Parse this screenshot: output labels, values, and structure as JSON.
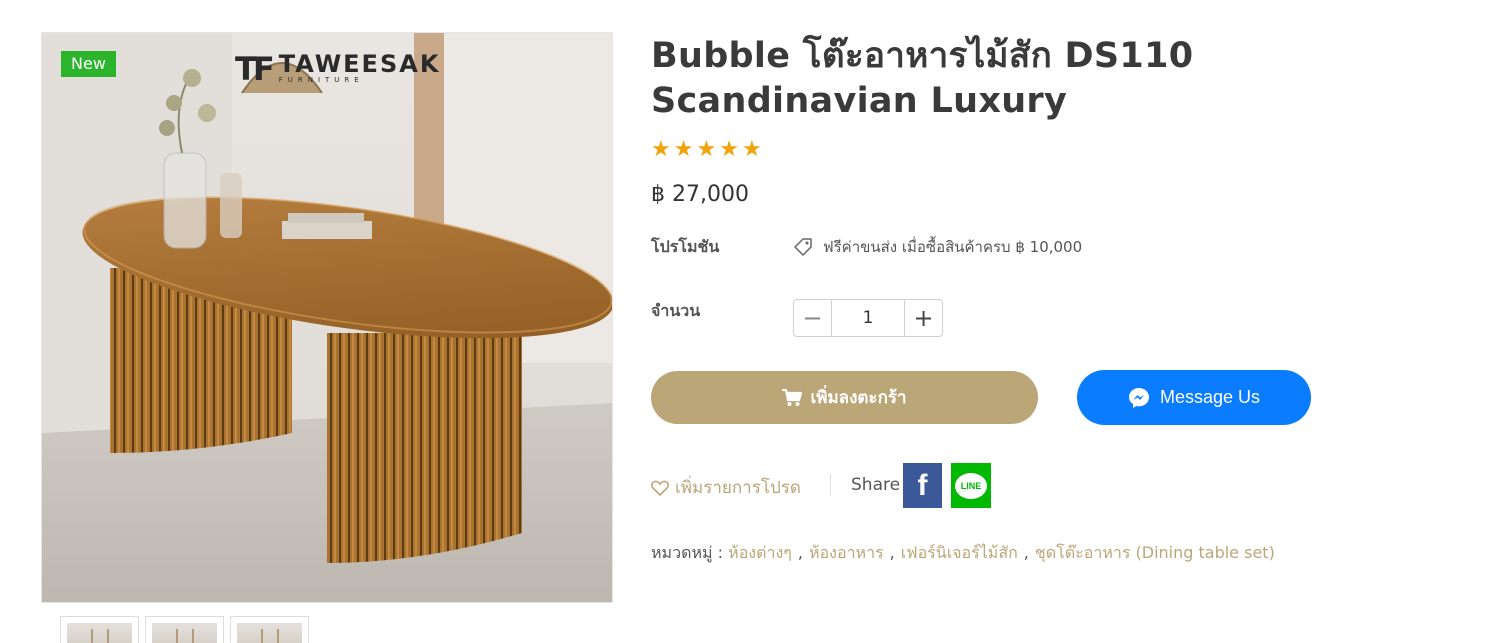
{
  "product_image": {
    "badge": "New",
    "brand_mark": "TF",
    "brand_name": "TAWEESAK",
    "brand_sub": "FURNITURE"
  },
  "thumbnails": [
    "thumb-1",
    "thumb-2",
    "thumb-3"
  ],
  "product": {
    "title": "Bubble โต๊ะอาหารไม้สัก DS110 Scandinavian Luxury",
    "rating": 5,
    "star_glyph": "★",
    "price": "฿ 27,000"
  },
  "promotion": {
    "label": "โปรโมชัน",
    "text": "ฟรีค่าขนส่ง เมื่อซื้อสินค้าครบ ฿ 10,000"
  },
  "quantity": {
    "label": "จำนวน",
    "value": "1",
    "minus": "−",
    "plus": "+"
  },
  "buttons": {
    "add_to_cart": "เพิ่มลงตะกร้า",
    "message_us": "Message Us"
  },
  "wishlist": {
    "label": "เพิ่มรายการโปรด"
  },
  "share": {
    "label": "Share",
    "facebook": "f",
    "line": "LINE"
  },
  "categories": {
    "label": "หมวดหมู่ :",
    "items": [
      "ห้องต่างๆ",
      "ห้องอาหาร",
      "เฟอร์นิเจอร์ไม้สัก",
      "ชุดโต๊ะอาหาร (Dining table set)"
    ],
    "separator": ","
  },
  "colors": {
    "accent": "#bba677",
    "messenger": "#0a7cff",
    "star": "#f0a30a",
    "new_badge": "#2cb52c"
  }
}
